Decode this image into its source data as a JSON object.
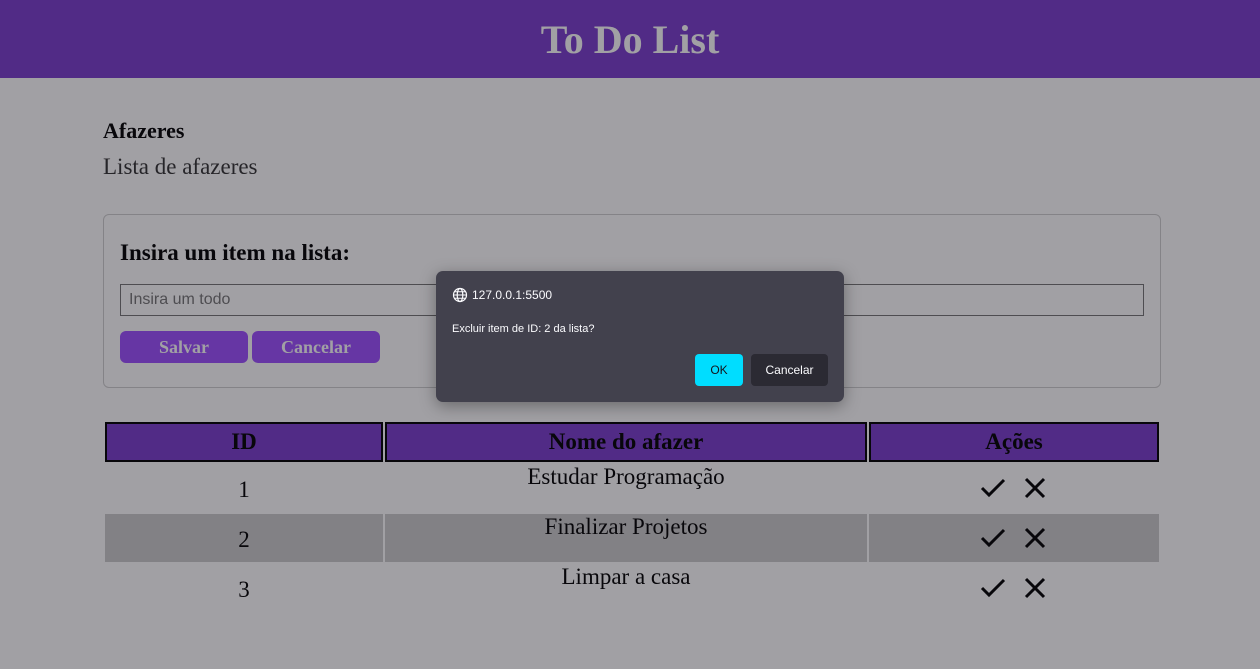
{
  "header": {
    "title": "To Do List"
  },
  "section": {
    "title": "Afazeres",
    "subtitle": "Lista de afazeres"
  },
  "form": {
    "title": "Insira um item na lista:",
    "input_placeholder": "Insira um todo",
    "input_value": "",
    "save_label": "Salvar",
    "cancel_label": "Cancelar"
  },
  "table": {
    "headers": [
      "ID",
      "Nome do afazer",
      "Ações"
    ],
    "rows": [
      {
        "id": "1",
        "name": "Estudar Programação"
      },
      {
        "id": "2",
        "name": "Finalizar Projetos"
      },
      {
        "id": "3",
        "name": "Limpar a casa"
      }
    ],
    "action_icons": [
      "check-icon",
      "close-icon"
    ]
  },
  "dialog": {
    "origin": "127.0.0.1:5500",
    "message": "Excluir item de ID: 2 da lista?",
    "ok_label": "OK",
    "cancel_label": "Cancelar"
  },
  "colors": {
    "accent": "#7a3ccd",
    "button": "#9d4fff",
    "dialog_bg": "#42414d",
    "dialog_ok": "#00ddff",
    "dialog_cancel": "#2b2a33"
  }
}
